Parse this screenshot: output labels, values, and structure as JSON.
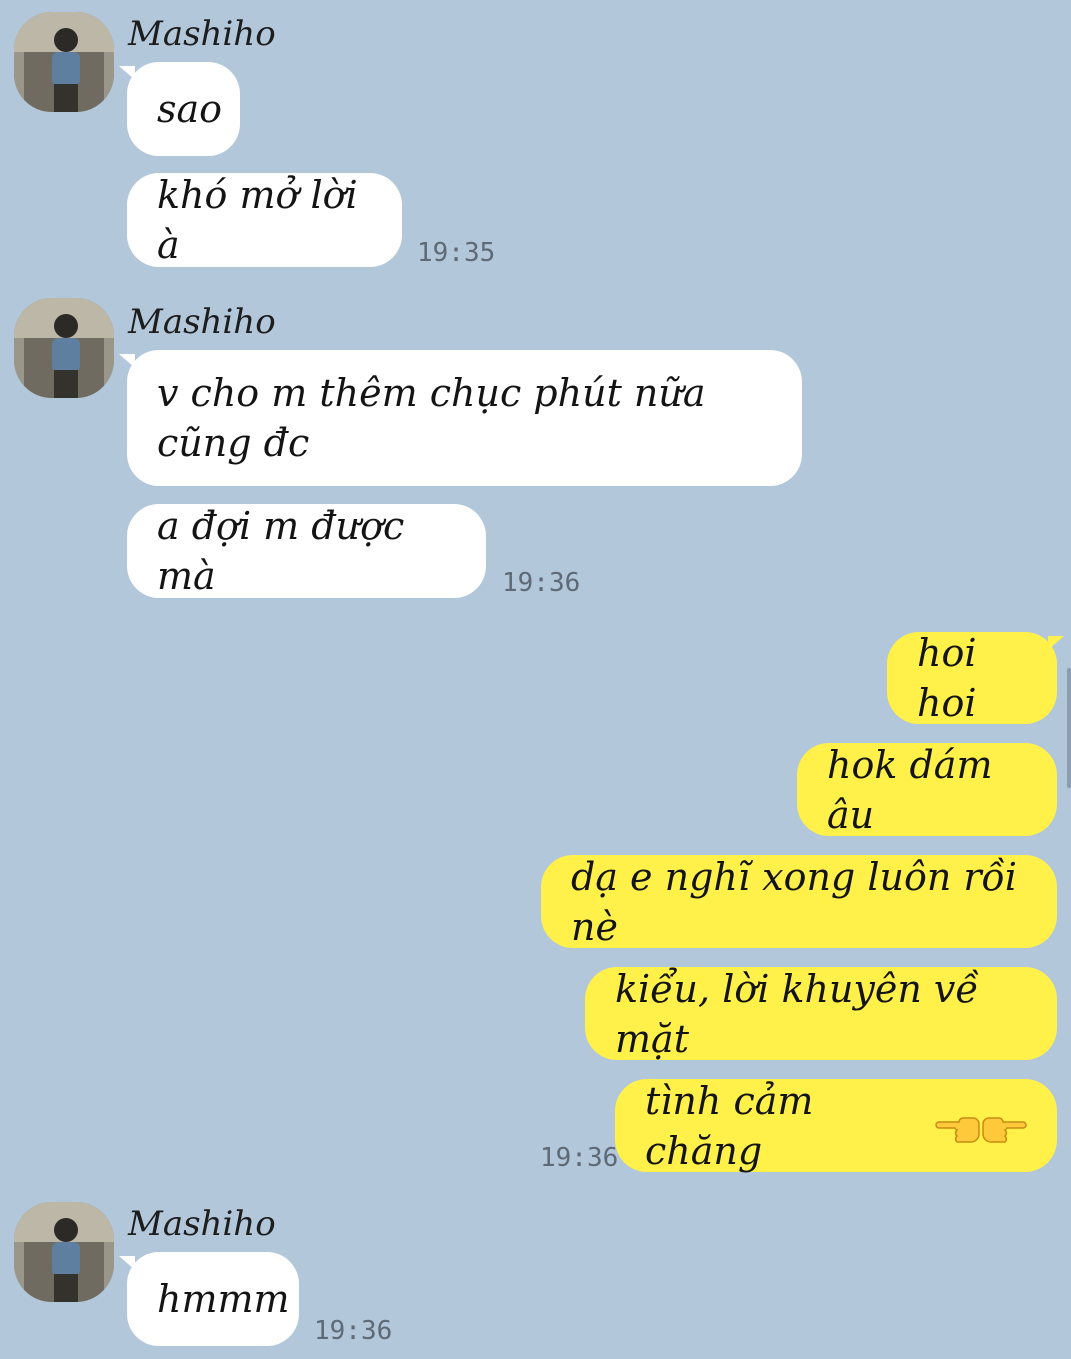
{
  "contact": {
    "name": "Mashiho"
  },
  "groups": [
    {
      "sender": "Mashiho",
      "messages": [
        "sao",
        "khó mở lời à"
      ],
      "time": "19:35"
    },
    {
      "sender": "Mashiho",
      "messages": [
        "v cho m thêm chục phút nữa cũng đc",
        "a đợi m được mà"
      ],
      "time": "19:36"
    },
    {
      "sender": "me",
      "messages": [
        "hoi hoi",
        "hok dám âu",
        "dạ e nghĩ xong luôn rồi nè",
        "kiểu, lời khuyên về mặt",
        "tình cảm chăng"
      ],
      "time": "19:36",
      "emoji": [
        "backhand-index-pointing-left",
        "backhand-index-pointing-right"
      ]
    },
    {
      "sender": "Mashiho",
      "messages": [
        "hmmm"
      ],
      "time": "19:36"
    }
  ],
  "colors": {
    "background": "#b3c7db",
    "incoming_bubble": "#ffffff",
    "outgoing_bubble": "#fff04a",
    "timestamp": "#5e6a75"
  }
}
